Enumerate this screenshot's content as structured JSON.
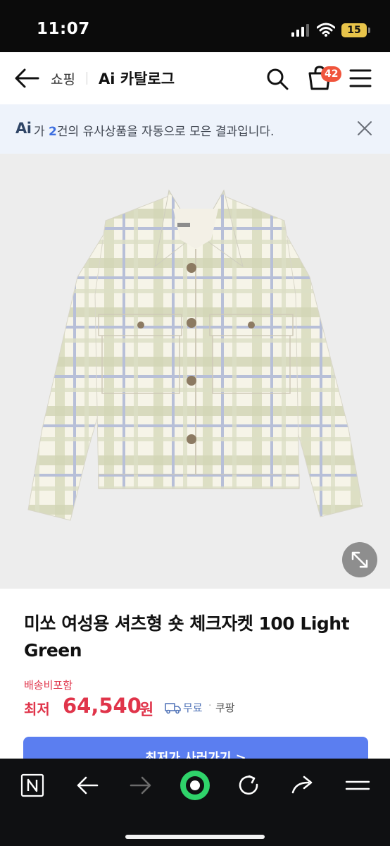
{
  "status_bar": {
    "time": "11:07",
    "battery_level": "15",
    "battery_color": "#e8c44a",
    "icons": [
      "signal-icon",
      "wifi-icon",
      "battery-icon"
    ]
  },
  "header": {
    "back_icon": "arrow-left-icon",
    "shop_label": "쇼핑",
    "title": "Ai 카탈로그",
    "search_icon": "search-icon",
    "cart_icon": "cart-icon",
    "cart_count": "42",
    "menu_icon": "hamburger-menu-icon"
  },
  "ai_notice": {
    "logo": "Ai",
    "text_prefix": "가 ",
    "count": "2",
    "text_suffix": "건의 유사상품을 자동으로 모은 결과입니다.",
    "close_icon": "close-icon",
    "background": "#eef3fb"
  },
  "product": {
    "image_alt": "plaid shirt jacket",
    "expand_icon": "expand-icon",
    "title": "미쏘 여성용 셔츠형 숏 체크자켓 100 Light Green",
    "shipping_label": "배송비포함",
    "price_prefix": "최저",
    "price": "64,540",
    "price_unit": "원",
    "delivery": "무료",
    "seller": "쿠팡",
    "buy_button": "최저가 사러가기 >",
    "accent_color": "#e0344a",
    "button_color": "#5b7ef0"
  },
  "toolbar": {
    "items": [
      "naver-n-icon",
      "back-arrow-icon",
      "forward-arrow-icon",
      "green-dot-icon",
      "refresh-icon",
      "share-icon",
      "menu-icon"
    ],
    "green_dot_color": "#2fd36a"
  }
}
